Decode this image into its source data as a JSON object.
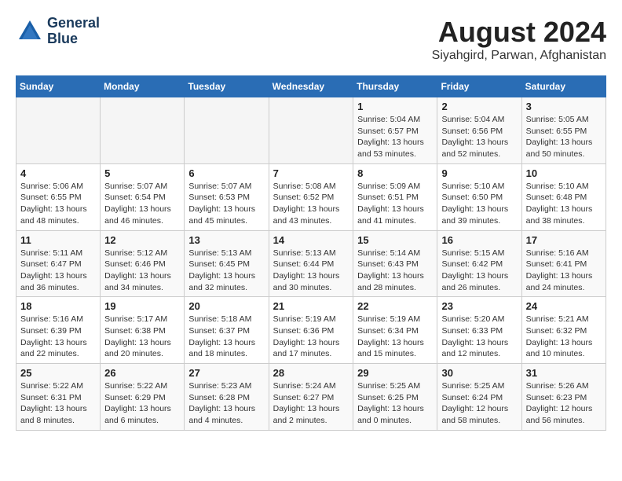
{
  "header": {
    "logo_line1": "General",
    "logo_line2": "Blue",
    "month": "August 2024",
    "location": "Siyahgird, Parwan, Afghanistan"
  },
  "weekdays": [
    "Sunday",
    "Monday",
    "Tuesday",
    "Wednesday",
    "Thursday",
    "Friday",
    "Saturday"
  ],
  "weeks": [
    [
      {
        "day": "",
        "info": ""
      },
      {
        "day": "",
        "info": ""
      },
      {
        "day": "",
        "info": ""
      },
      {
        "day": "",
        "info": ""
      },
      {
        "day": "1",
        "info": "Sunrise: 5:04 AM\nSunset: 6:57 PM\nDaylight: 13 hours\nand 53 minutes."
      },
      {
        "day": "2",
        "info": "Sunrise: 5:04 AM\nSunset: 6:56 PM\nDaylight: 13 hours\nand 52 minutes."
      },
      {
        "day": "3",
        "info": "Sunrise: 5:05 AM\nSunset: 6:55 PM\nDaylight: 13 hours\nand 50 minutes."
      }
    ],
    [
      {
        "day": "4",
        "info": "Sunrise: 5:06 AM\nSunset: 6:55 PM\nDaylight: 13 hours\nand 48 minutes."
      },
      {
        "day": "5",
        "info": "Sunrise: 5:07 AM\nSunset: 6:54 PM\nDaylight: 13 hours\nand 46 minutes."
      },
      {
        "day": "6",
        "info": "Sunrise: 5:07 AM\nSunset: 6:53 PM\nDaylight: 13 hours\nand 45 minutes."
      },
      {
        "day": "7",
        "info": "Sunrise: 5:08 AM\nSunset: 6:52 PM\nDaylight: 13 hours\nand 43 minutes."
      },
      {
        "day": "8",
        "info": "Sunrise: 5:09 AM\nSunset: 6:51 PM\nDaylight: 13 hours\nand 41 minutes."
      },
      {
        "day": "9",
        "info": "Sunrise: 5:10 AM\nSunset: 6:50 PM\nDaylight: 13 hours\nand 39 minutes."
      },
      {
        "day": "10",
        "info": "Sunrise: 5:10 AM\nSunset: 6:48 PM\nDaylight: 13 hours\nand 38 minutes."
      }
    ],
    [
      {
        "day": "11",
        "info": "Sunrise: 5:11 AM\nSunset: 6:47 PM\nDaylight: 13 hours\nand 36 minutes."
      },
      {
        "day": "12",
        "info": "Sunrise: 5:12 AM\nSunset: 6:46 PM\nDaylight: 13 hours\nand 34 minutes."
      },
      {
        "day": "13",
        "info": "Sunrise: 5:13 AM\nSunset: 6:45 PM\nDaylight: 13 hours\nand 32 minutes."
      },
      {
        "day": "14",
        "info": "Sunrise: 5:13 AM\nSunset: 6:44 PM\nDaylight: 13 hours\nand 30 minutes."
      },
      {
        "day": "15",
        "info": "Sunrise: 5:14 AM\nSunset: 6:43 PM\nDaylight: 13 hours\nand 28 minutes."
      },
      {
        "day": "16",
        "info": "Sunrise: 5:15 AM\nSunset: 6:42 PM\nDaylight: 13 hours\nand 26 minutes."
      },
      {
        "day": "17",
        "info": "Sunrise: 5:16 AM\nSunset: 6:41 PM\nDaylight: 13 hours\nand 24 minutes."
      }
    ],
    [
      {
        "day": "18",
        "info": "Sunrise: 5:16 AM\nSunset: 6:39 PM\nDaylight: 13 hours\nand 22 minutes."
      },
      {
        "day": "19",
        "info": "Sunrise: 5:17 AM\nSunset: 6:38 PM\nDaylight: 13 hours\nand 20 minutes."
      },
      {
        "day": "20",
        "info": "Sunrise: 5:18 AM\nSunset: 6:37 PM\nDaylight: 13 hours\nand 18 minutes."
      },
      {
        "day": "21",
        "info": "Sunrise: 5:19 AM\nSunset: 6:36 PM\nDaylight: 13 hours\nand 17 minutes."
      },
      {
        "day": "22",
        "info": "Sunrise: 5:19 AM\nSunset: 6:34 PM\nDaylight: 13 hours\nand 15 minutes."
      },
      {
        "day": "23",
        "info": "Sunrise: 5:20 AM\nSunset: 6:33 PM\nDaylight: 13 hours\nand 12 minutes."
      },
      {
        "day": "24",
        "info": "Sunrise: 5:21 AM\nSunset: 6:32 PM\nDaylight: 13 hours\nand 10 minutes."
      }
    ],
    [
      {
        "day": "25",
        "info": "Sunrise: 5:22 AM\nSunset: 6:31 PM\nDaylight: 13 hours\nand 8 minutes."
      },
      {
        "day": "26",
        "info": "Sunrise: 5:22 AM\nSunset: 6:29 PM\nDaylight: 13 hours\nand 6 minutes."
      },
      {
        "day": "27",
        "info": "Sunrise: 5:23 AM\nSunset: 6:28 PM\nDaylight: 13 hours\nand 4 minutes."
      },
      {
        "day": "28",
        "info": "Sunrise: 5:24 AM\nSunset: 6:27 PM\nDaylight: 13 hours\nand 2 minutes."
      },
      {
        "day": "29",
        "info": "Sunrise: 5:25 AM\nSunset: 6:25 PM\nDaylight: 13 hours\nand 0 minutes."
      },
      {
        "day": "30",
        "info": "Sunrise: 5:25 AM\nSunset: 6:24 PM\nDaylight: 12 hours\nand 58 minutes."
      },
      {
        "day": "31",
        "info": "Sunrise: 5:26 AM\nSunset: 6:23 PM\nDaylight: 12 hours\nand 56 minutes."
      }
    ]
  ]
}
